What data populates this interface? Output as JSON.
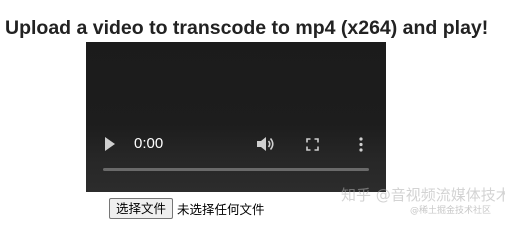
{
  "page": {
    "title": "Upload a video to transcode to mp4 (x264) and play!"
  },
  "video": {
    "current_time": "0:00",
    "progress": 0,
    "controls": {
      "play": "play-icon",
      "volume": "volume-icon",
      "fullscreen": "fullscreen-icon",
      "more": "more-options-icon"
    }
  },
  "file_input": {
    "button_label": "选择文件",
    "status_text": "未选择任何文件"
  },
  "watermark": {
    "main": "知乎 @音视频流媒体技术",
    "sub": "@稀土掘金技术社区"
  },
  "colors": {
    "video_background": "#1c1c1c",
    "control_icons": "#cfcfcf",
    "time_text": "#ffffff",
    "progress_track": "#6a6a6a",
    "title_text": "#222222"
  }
}
